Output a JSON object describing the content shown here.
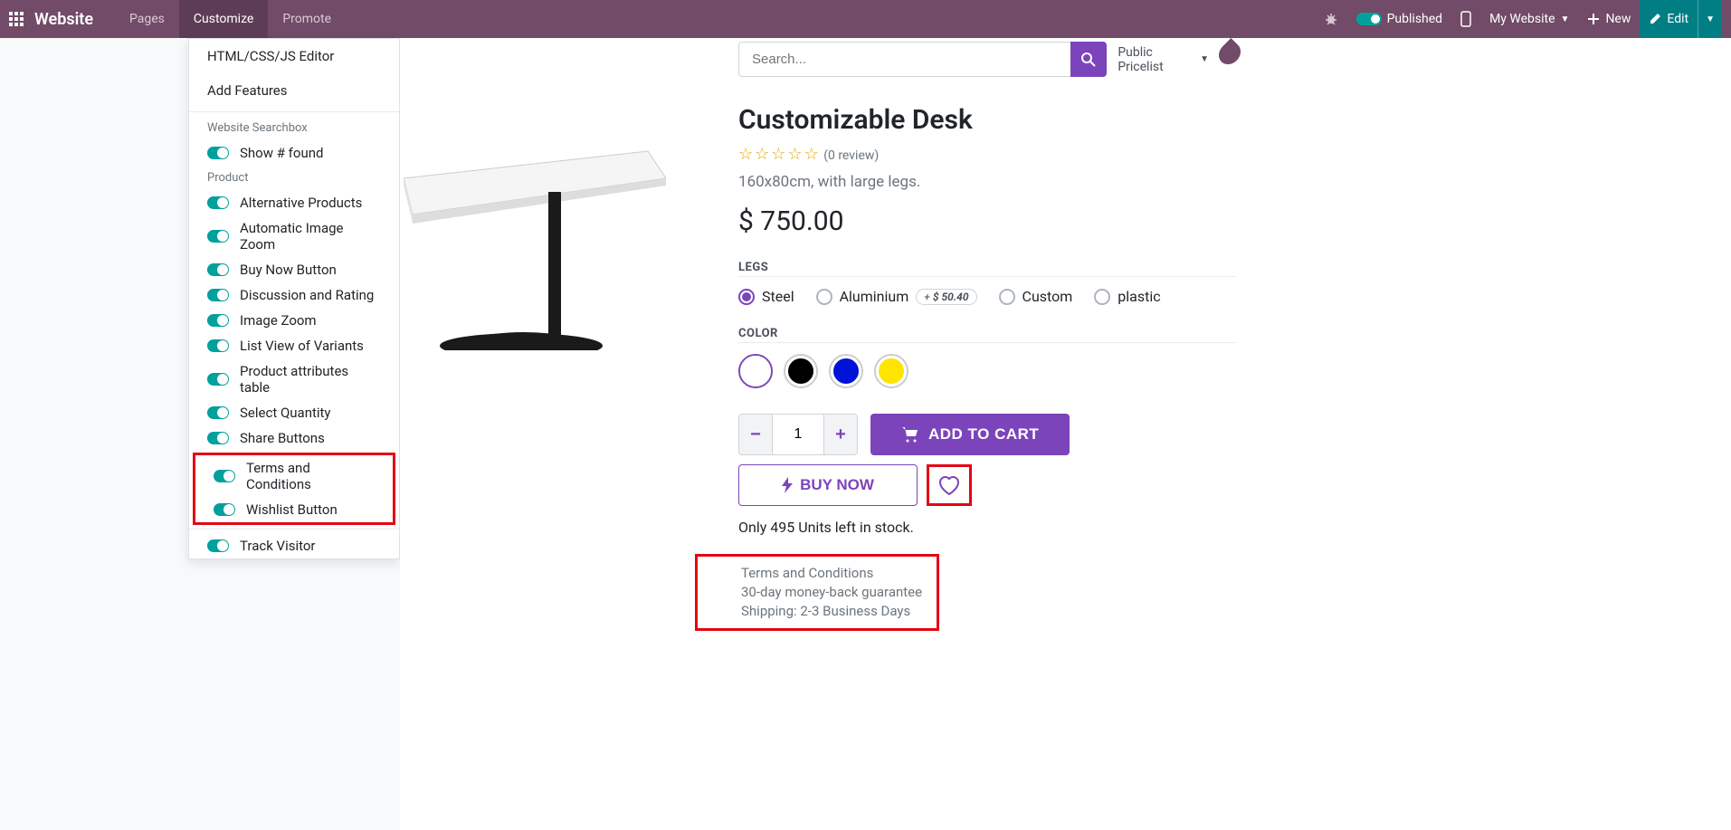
{
  "topbar": {
    "brand": "Website",
    "menu": {
      "pages": "Pages",
      "customize": "Customize",
      "promote": "Promote"
    },
    "published": "Published",
    "my_website": "My Website",
    "new": "New",
    "edit": "Edit"
  },
  "customize_panel": {
    "html_editor": "HTML/CSS/JS Editor",
    "add_features": "Add Features",
    "section_searchbox": "Website Searchbox",
    "show_found": "Show # found",
    "section_product": "Product",
    "toggles": {
      "alt_products": "Alternative Products",
      "auto_zoom": "Automatic Image Zoom",
      "buy_now": "Buy Now Button",
      "discussion": "Discussion and Rating",
      "image_zoom": "Image Zoom",
      "list_variants": "List View of Variants",
      "attr_table": "Product attributes table",
      "select_qty": "Select Quantity",
      "share_buttons": "Share Buttons",
      "terms": "Terms and Conditions",
      "wishlist": "Wishlist Button"
    },
    "track_visitor": "Track Visitor"
  },
  "search": {
    "placeholder": "Search...",
    "pricelist": "Public Pricelist"
  },
  "product": {
    "title": "Customizable Desk",
    "review": "(0 review)",
    "subtitle": "160x80cm, with large legs.",
    "price": "$ 750.00",
    "legs_label": "LEGS",
    "legs": {
      "steel": "Steel",
      "aluminium": "Aluminium",
      "surcharge": "$ 50.40",
      "custom": "Custom",
      "plastic": "plastic"
    },
    "color_label": "COLOR",
    "qty": "1",
    "add_to_cart": "ADD TO CART",
    "buy_now": "BUY NOW",
    "stock": "Only 495 Units left in stock.",
    "terms_title": "Terms and Conditions",
    "guarantee": "30-day money-back guarantee",
    "shipping": "Shipping: 2-3 Business Days"
  }
}
